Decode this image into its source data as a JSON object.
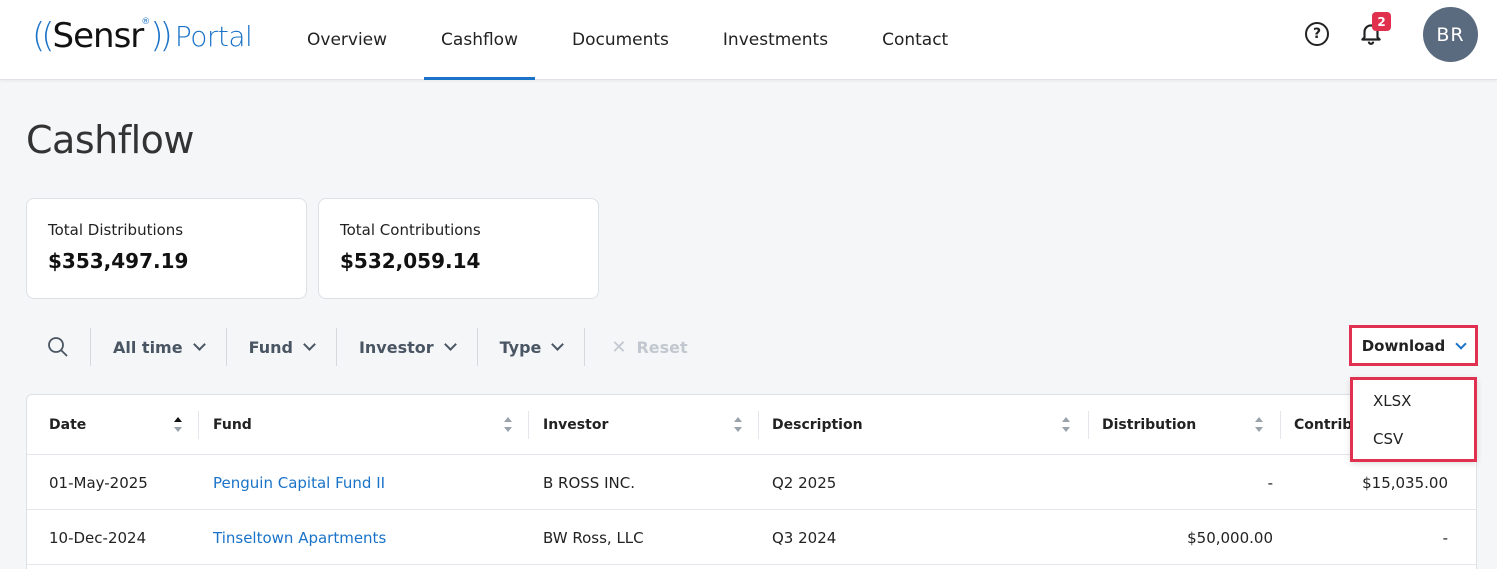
{
  "header": {
    "logo": {
      "brand": "Sensr",
      "reg": "®",
      "portal": "Portal"
    },
    "nav": [
      {
        "label": "Overview",
        "active": false
      },
      {
        "label": "Cashflow",
        "active": true
      },
      {
        "label": "Documents",
        "active": false
      },
      {
        "label": "Investments",
        "active": false
      },
      {
        "label": "Contact",
        "active": false
      }
    ],
    "help_glyph": "?",
    "notification_count": "2",
    "avatar_initials": "BR"
  },
  "page": {
    "title": "Cashflow"
  },
  "summary": [
    {
      "label": "Total Distributions",
      "value": "$353,497.19"
    },
    {
      "label": "Total Contributions",
      "value": "$532,059.14"
    }
  ],
  "filters": {
    "items": [
      "All time",
      "Fund",
      "Investor",
      "Type"
    ],
    "reset_label": "Reset"
  },
  "download": {
    "label": "Download",
    "options": [
      "XLSX",
      "CSV"
    ]
  },
  "table": {
    "columns": [
      "Date",
      "Fund",
      "Investor",
      "Description",
      "Distribution",
      "Contribu"
    ],
    "rows": [
      {
        "date": "01-May-2025",
        "fund": "Penguin Capital Fund II",
        "investor": "B ROSS INC.",
        "description": "Q2 2025",
        "distribution": "-",
        "contribution": "$15,035.00"
      },
      {
        "date": "10-Dec-2024",
        "fund": "Tinseltown Apartments",
        "investor": "BW Ross, LLC",
        "description": "Q3 2024",
        "distribution": "$50,000.00",
        "contribution": "-"
      }
    ]
  },
  "colors": {
    "accent": "#1a73c8",
    "highlight": "#e03150",
    "badge": "#e0304d",
    "avatar": "#5b6b7f"
  }
}
